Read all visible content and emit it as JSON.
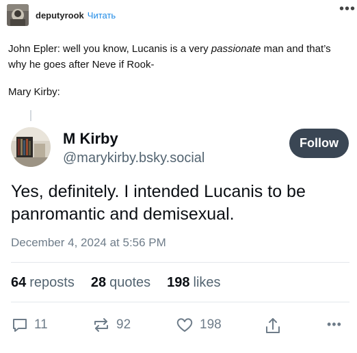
{
  "header": {
    "username": "deputyrook",
    "follow_label": "Читать",
    "more_icon": "more-horizontal-icon"
  },
  "post": {
    "paragraph_1_prefix": "John Epler: well you know, Lucanis is a very ",
    "paragraph_1_emphasis": "passionate",
    "paragraph_1_suffix": " man and that’s why he goes after Neve if Rook-",
    "paragraph_2": "Mary Kirby:"
  },
  "bsky": {
    "display_name": "M Kirby",
    "handle": "@marykirby.bsky.social",
    "follow_button": "Follow",
    "text": "Yes, definitely. I intended Lucanis to be panromantic and demisexual.",
    "date": "December 4, 2024 at 5:56 PM",
    "stats": {
      "reposts_count": "64",
      "reposts_label": "reposts",
      "quotes_count": "28",
      "quotes_label": "quotes",
      "likes_count": "198",
      "likes_label": "likes"
    },
    "actions": {
      "reply_count": "11",
      "repost_count": "92",
      "like_count": "198",
      "icons": [
        "reply-icon",
        "repost-icon",
        "like-icon",
        "share-icon",
        "more-horizontal-icon"
      ]
    }
  },
  "colors": {
    "link_blue": "#1e8ae6",
    "button_bg": "#3a4654",
    "secondary_text": "#536471",
    "muted_text": "#6e7c89"
  }
}
